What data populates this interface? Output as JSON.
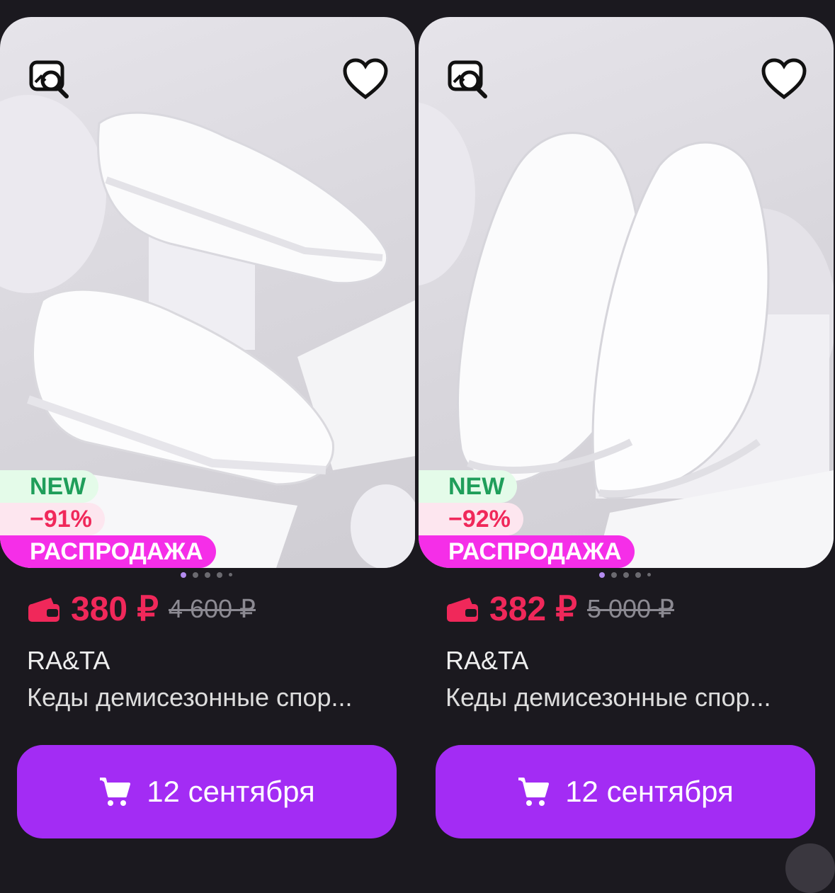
{
  "products": [
    {
      "badges": {
        "new": "NEW",
        "discount": "−91%",
        "sale": "РАСПРОДАЖА"
      },
      "price": "380 ₽",
      "old_price": "4 600 ₽",
      "brand": "RA&TA",
      "title": "Кеды демисезонные спор...",
      "cart_label": "12 сентября",
      "icons": [
        "image-search-icon",
        "heart-icon",
        "wallet-icon",
        "cart-icon"
      ]
    },
    {
      "badges": {
        "new": "NEW",
        "discount": "−92%",
        "sale": "РАСПРОДАЖА"
      },
      "price": "382 ₽",
      "old_price": "5 000 ₽",
      "brand": "RA&TA",
      "title": "Кеды демисезонные спор...",
      "cart_label": "12 сентября",
      "icons": [
        "image-search-icon",
        "heart-icon",
        "wallet-icon",
        "cart-icon"
      ]
    }
  ],
  "colors": {
    "background": "#1b191f",
    "price": "#f0285a",
    "sale_badge": "#f52ee8",
    "new_badge_text": "#1f9e5a",
    "cart_button": "#a32cf4"
  }
}
